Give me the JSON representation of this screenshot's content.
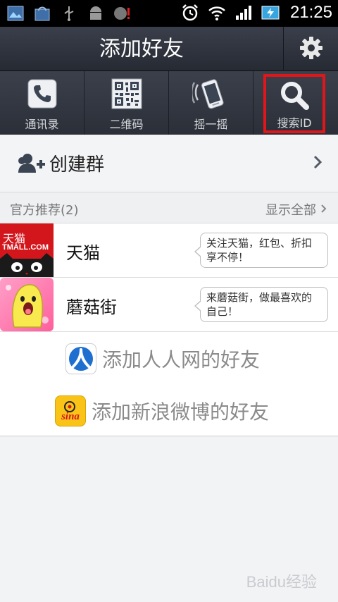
{
  "status_bar": {
    "time": "21:25",
    "icons": [
      "image-notification-icon",
      "shopping-bag-icon",
      "usb-icon",
      "android-debug-icon",
      "alert-icon",
      "alarm-icon",
      "wifi-icon",
      "signal-icon",
      "battery-charging-icon"
    ]
  },
  "header": {
    "title": "添加好友",
    "settings_icon": "gear-icon"
  },
  "tabs": [
    {
      "label": "通讯录",
      "icon": "phone-book-icon"
    },
    {
      "label": "二维码",
      "icon": "qr-code-icon"
    },
    {
      "label": "摇一摇",
      "icon": "shake-phone-icon"
    },
    {
      "label": "搜索ID",
      "icon": "search-icon",
      "highlight_color": "#e0161b"
    }
  ],
  "create_group": {
    "label": "创建群",
    "icon": "add-group-icon"
  },
  "official": {
    "title": "官方推荐(2)",
    "show_all": "显示全部",
    "items": [
      {
        "name": "天猫",
        "desc": "关注天猫，红包、折扣享不停！",
        "thumb_text_1": "天猫",
        "thumb_text_2": "TMALL.COM"
      },
      {
        "name": "蘑菇街",
        "desc": "来蘑菇街，做最喜欢的自己！"
      }
    ]
  },
  "links": {
    "renren": "添加人人网的好友",
    "sina": "添加新浪微博的好友",
    "sina_logo_text": "sina"
  },
  "watermark": "Baidu经验",
  "colors": {
    "accent_red": "#e0161b",
    "header_dark": "#2b2f38",
    "tmall_red": "#d3161c"
  }
}
